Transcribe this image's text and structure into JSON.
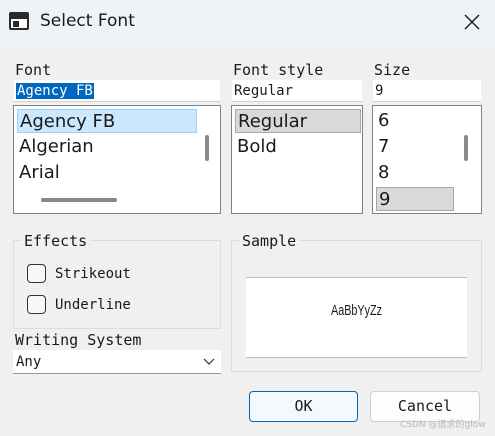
{
  "window": {
    "title": "Select Font",
    "icons": [
      "app-icon",
      "close-icon"
    ]
  },
  "font": {
    "label": "Font",
    "value": "Agency FB",
    "items": [
      "Agency FB",
      "Algerian",
      "Arial"
    ],
    "selected": "Agency FB"
  },
  "style": {
    "label": "Font style",
    "value": "Regular",
    "items": [
      "Regular",
      "Bold"
    ],
    "selected": "Regular"
  },
  "size": {
    "label": "Size",
    "value": "9",
    "items": [
      "6",
      "7",
      "8",
      "9"
    ],
    "selected": "9"
  },
  "effects": {
    "label": "Effects",
    "strikeout_label": "Strikeout",
    "strikeout_checked": false,
    "underline_label": "Underline",
    "underline_checked": false
  },
  "sample": {
    "label": "Sample",
    "text": "AaBbYyZz"
  },
  "writing_system": {
    "label": "Writing System",
    "value": "Any"
  },
  "buttons": {
    "ok": "OK",
    "cancel": "Cancel"
  },
  "watermark": "CSDN @追求的glow"
}
